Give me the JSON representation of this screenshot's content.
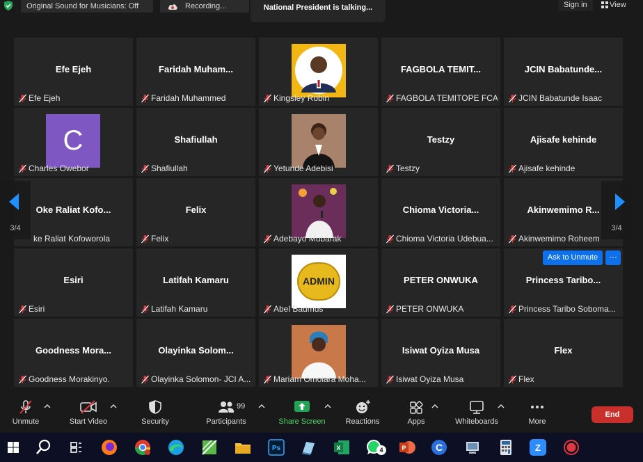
{
  "topbar": {
    "sound_label": "Original Sound for Musicians: Off",
    "recording_label": "Recording...",
    "talking_label": "National President is talking...",
    "signin_label": "Sign in",
    "view_label": "View"
  },
  "grid": {
    "page_left": "3/4",
    "page_right": "3/4",
    "ask_unmute_label": "Ask to Unmute",
    "more_label": "···",
    "tiles": [
      {
        "big": "Efe Ejeh",
        "label": "Efe Ejeh"
      },
      {
        "big": "Faridah Muham...",
        "label": "Faridah Muhammed"
      },
      {
        "big": "",
        "label": "Kingsley Robin"
      },
      {
        "big": "FAGBOLA TEMIT...",
        "label": "FAGBOLA TEMITOPE FCA"
      },
      {
        "big": "JCIN Babatunde...",
        "label": "JCIN Babatunde Isaac"
      },
      {
        "big": "",
        "label": "Charles Owebor",
        "avatar_letter": "C"
      },
      {
        "big": "Shafiullah",
        "label": "Shafiullah"
      },
      {
        "big": "",
        "label": "Yetunde Adebisi"
      },
      {
        "big": "Testzy",
        "label": "Testzy"
      },
      {
        "big": "Ajisafe kehinde",
        "label": "Ajisafe kehinde"
      },
      {
        "big": "Oke Raliat Kofo...",
        "label": "ke Raliat Kofoworola"
      },
      {
        "big": "Felix",
        "label": "Felix"
      },
      {
        "big": "",
        "label": "Adebayo Mubarak"
      },
      {
        "big": "Chioma Victoria...",
        "label": "Chioma Victoria Udebua..."
      },
      {
        "big": "Akinwemimo R...",
        "label": "Akinwemimo Roheem"
      },
      {
        "big": "Esiri",
        "label": "Esiri"
      },
      {
        "big": "Latifah Kamaru",
        "label": "Latifah Kamaru"
      },
      {
        "big": "",
        "label": "Abel Badmus",
        "image_text": "ADMIN"
      },
      {
        "big": "PETER ONWUKA",
        "label": "PETER ONWUKA"
      },
      {
        "big": "Princess Taribo...",
        "label": "Princess Taribo Soboma..."
      },
      {
        "big": "Goodness Mora...",
        "label": "Goodness Morakinyo."
      },
      {
        "big": "Olayinka Solom...",
        "label": "Olayinka Solomon- JCI A..."
      },
      {
        "big": "",
        "label": "Mariam Omolara Moha..."
      },
      {
        "big": "Isiwat Oyiza Musa",
        "label": "Isiwat Oyiza Musa"
      },
      {
        "big": "Flex",
        "label": "Flex"
      }
    ]
  },
  "toolbar": {
    "unmute": "Unmute",
    "start_video": "Start Video",
    "security": "Security",
    "participants": "Participants",
    "participants_count": "99",
    "share_screen": "Share Screen",
    "reactions": "Reactions",
    "apps": "Apps",
    "whiteboards": "Whiteboards",
    "more": "More",
    "end": "End"
  },
  "taskbar": {
    "whatsapp_badge": "4"
  },
  "colors": {
    "tile_bg": "#262626",
    "accent_blue": "#0e71eb",
    "share_green": "#4cd964",
    "end_red": "#c9302c",
    "muted_red": "#e0383e"
  }
}
